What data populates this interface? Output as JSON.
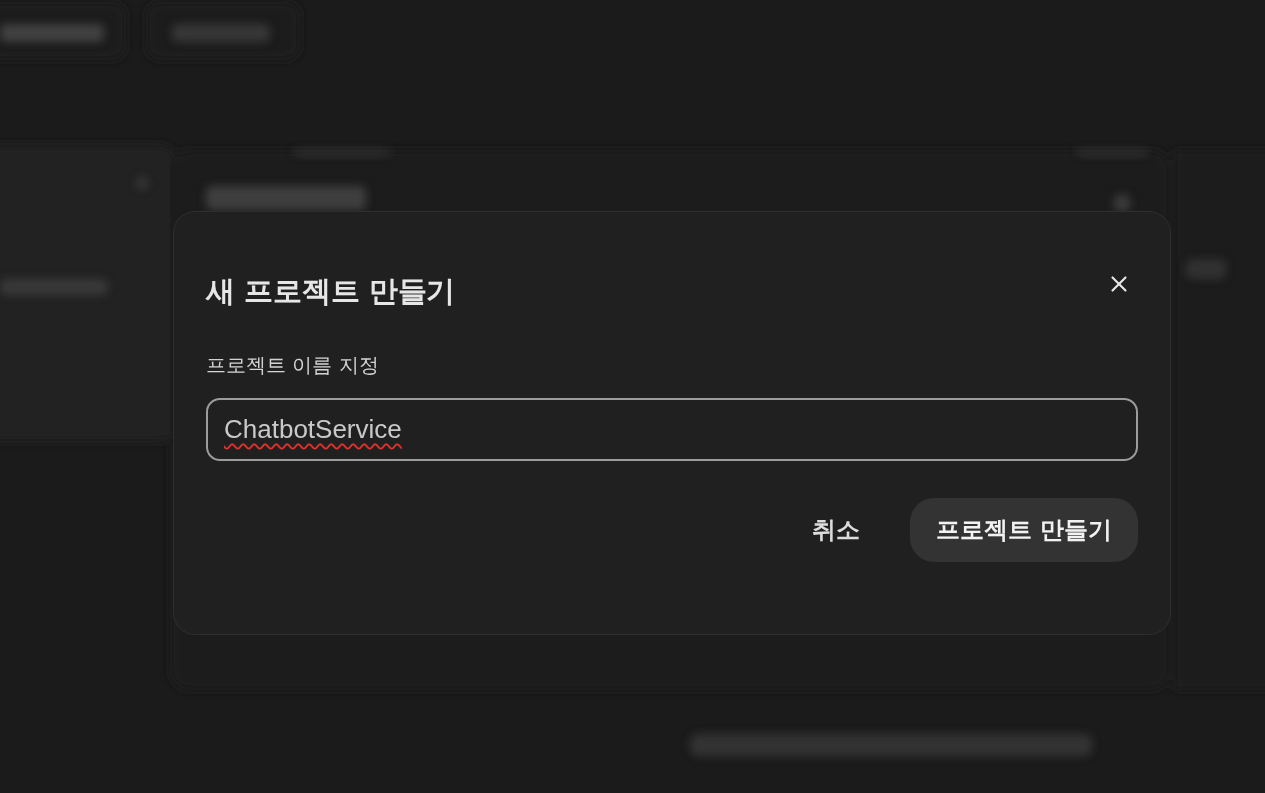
{
  "dialog": {
    "title": "새 프로젝트 만들기",
    "field": {
      "label": "프로젝트 이름 지정",
      "value": "ChatbotService",
      "focused": true,
      "misspelled": true
    },
    "buttons": [
      {
        "label": "취소",
        "kind": "text"
      },
      {
        "label": "프로젝트 만들기",
        "kind": "filled"
      }
    ]
  }
}
